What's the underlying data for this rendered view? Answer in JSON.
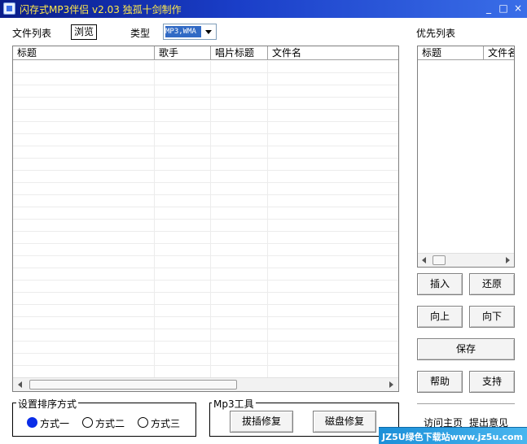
{
  "window": {
    "title": "闪存式MP3伴侣 v2.03 独孤十剑制作",
    "controls": {
      "minimize": "_",
      "maximize": "□",
      "close": "×"
    }
  },
  "toolbar": {
    "file_list_label": "文件列表",
    "browse_button": "浏览",
    "type_label": "类型",
    "type_value": "MP3,WMA",
    "priority_list_label": "优先列表"
  },
  "file_list": {
    "columns": [
      "标题",
      "歌手",
      "唱片标题",
      "文件名"
    ],
    "rows": []
  },
  "priority_list": {
    "columns": [
      "标题",
      "文件名"
    ],
    "rows": []
  },
  "priority_buttons": {
    "insert": "插入",
    "restore": "还原",
    "up": "向上",
    "down": "向下",
    "save": "保存",
    "help": "帮助",
    "support": "支持"
  },
  "sort_group": {
    "title": "设置排序方式",
    "options": [
      "方式一",
      "方式二",
      "方式三"
    ],
    "selected": "方式一"
  },
  "mp3_tools": {
    "title": "Mp3工具",
    "plug_repair": "拔插修复",
    "disk_repair": "磁盘修复"
  },
  "links": {
    "homepage": "访问主页",
    "feedback": "提出意见"
  },
  "watermark": {
    "text": "JZ5U绿色下载站www.jz5u.com"
  }
}
